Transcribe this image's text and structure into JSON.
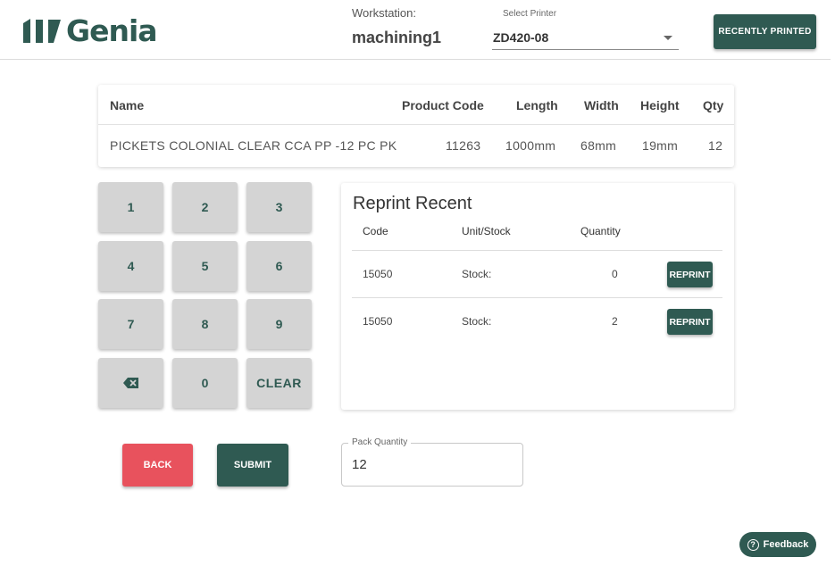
{
  "brand": {
    "name": "Genia",
    "color": "#2f5a52",
    "icon": "genia-logo-icon"
  },
  "header": {
    "workstation_label": "Workstation:",
    "workstation_value": "machining1",
    "printer_label": "Select Printer",
    "printer_value": "ZD420-08",
    "recently_printed_label": "RECENTLY PRINTED"
  },
  "product_table": {
    "columns": [
      "Name",
      "Product Code",
      "Length",
      "Width",
      "Height",
      "Qty"
    ],
    "row": {
      "name": "PICKETS COLONIAL CLEAR CCA PP -12 PC PK",
      "product_code": "11263",
      "length": "1000mm",
      "width": "68mm",
      "height": "19mm",
      "qty": "12"
    }
  },
  "keypad": {
    "keys": [
      "1",
      "2",
      "3",
      "4",
      "5",
      "6",
      "7",
      "8",
      "9",
      "",
      "0",
      "CLEAR"
    ],
    "backspace_icon": "backspace-icon"
  },
  "reprint": {
    "title": "Reprint Recent",
    "columns": [
      "Code",
      "Unit/Stock",
      "Quantity"
    ],
    "rows": [
      {
        "code": "15050",
        "unit_stock": "Stock:",
        "quantity": "0",
        "action": "REPRINT"
      },
      {
        "code": "15050",
        "unit_stock": "Stock:",
        "quantity": "2",
        "action": "REPRINT"
      }
    ]
  },
  "actions": {
    "back_label": "BACK",
    "submit_label": "SUBMIT",
    "back_color": "#e8525d"
  },
  "pack_quantity": {
    "label": "Pack Quantity",
    "value": "12"
  },
  "feedback": {
    "label": "Feedback",
    "icon": "help-circle-icon"
  }
}
